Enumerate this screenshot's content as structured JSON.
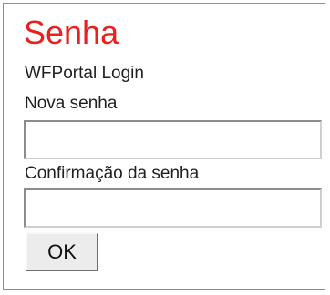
{
  "form": {
    "title": "Senha",
    "subtitle": "WFPortal Login",
    "new_password_label": "Nova senha",
    "new_password_value": "",
    "confirm_password_label": "Confirmação da senha",
    "confirm_password_value": "",
    "ok_label": "OK"
  },
  "colors": {
    "title": "#e8201e",
    "text": "#1f1f1f",
    "border": "#8c8c8c",
    "button_face": "#ececec"
  }
}
